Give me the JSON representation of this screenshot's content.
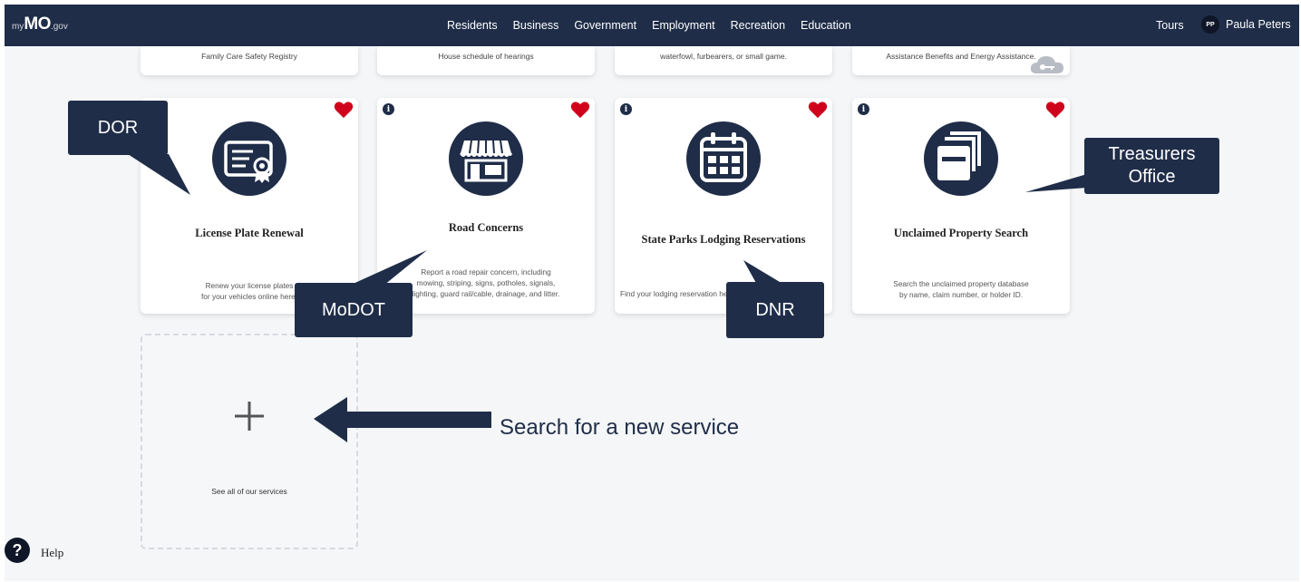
{
  "header": {
    "logo": {
      "my": "my",
      "mo": "MO",
      "gov": ".gov"
    },
    "nav": [
      "Residents",
      "Business",
      "Government",
      "Employment",
      "Recreation",
      "Education"
    ],
    "tours": "Tours",
    "user": {
      "initials": "PP",
      "name": "Paula Peters"
    }
  },
  "top_cards": [
    {
      "text": "Family Care Safety Registry"
    },
    {
      "text": "House schedule of hearings"
    },
    {
      "text": "waterfowl, furbearers, or small game."
    },
    {
      "text": "Assistance Benefits and Energy Assistance."
    }
  ],
  "cards": [
    {
      "title": "License Plate Renewal",
      "desc": [
        "Renew your license plates",
        "for your vehicles online here."
      ],
      "icon": "certificate-icon"
    },
    {
      "title": "Road Concerns",
      "desc": [
        "Report a road repair concern, including",
        "mowing, striping, signs, potholes, signals,",
        "lighting, guard rail/cable, drainage, and litter."
      ],
      "icon": "storefront-icon"
    },
    {
      "title": "State Parks Lodging Reservations",
      "desc": [
        "Find your lodging reservation here."
      ],
      "icon": "calendar-icon"
    },
    {
      "title": "Unclaimed Property Search",
      "desc": [
        "Search the unclaimed property database",
        "by name, claim number, or holder ID."
      ],
      "icon": "file-drawer-icon"
    }
  ],
  "add_card": {
    "label": "See all of our services"
  },
  "callouts": {
    "dor": "DOR",
    "modot": "MoDOT",
    "dnr": "DNR",
    "treasurers": [
      "Treasurers",
      "Office"
    ]
  },
  "annotation": {
    "search": "Search for a new service"
  },
  "help": {
    "label": "Help"
  },
  "colors": {
    "navy": "#1f2d48",
    "heart": "#d0021b",
    "background": "#f4f6f8"
  }
}
